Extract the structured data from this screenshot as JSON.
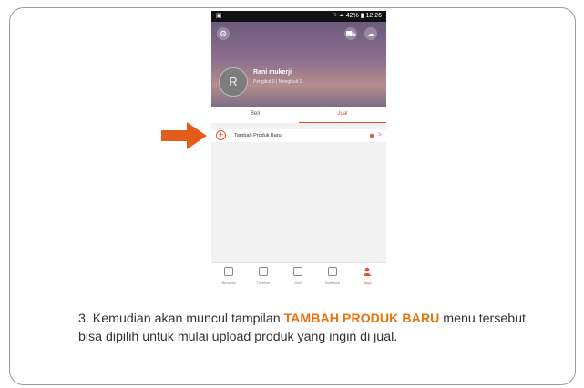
{
  "status_bar": {
    "left": "▣",
    "right": "⚐ ⏶ 42% ▮ 12:26"
  },
  "profile": {
    "name": "Rani mukerji",
    "stats": "Pengikut 0 | Mengikuti 1",
    "avatar_glyph": "R"
  },
  "tabs": [
    {
      "label": "Beli"
    },
    {
      "label": "Jual"
    }
  ],
  "menu_row": {
    "label": "Tambah Produk Baru",
    "icon": "plus-circle-icon",
    "chevron": ">"
  },
  "bottom_nav": [
    {
      "label": "Beranda",
      "icon": "home-icon"
    },
    {
      "label": "Timeline",
      "icon": "timeline-icon"
    },
    {
      "label": "Mall",
      "icon": "mall-icon"
    },
    {
      "label": "Notifikasi",
      "icon": "bell-icon"
    },
    {
      "label": "Saya",
      "icon": "user-icon"
    }
  ],
  "caption": {
    "part1": "3. Kemudian akan muncul tampilan ",
    "highlight": "TAMBAH PRODUK BARU",
    "part2": " menu tersebut bisa dipilih untuk mulai upload produk yang ingin di jual."
  },
  "colors": {
    "accent": "#ee4d2d",
    "arrow": "#e25d1c",
    "highlight": "#e8730f"
  }
}
